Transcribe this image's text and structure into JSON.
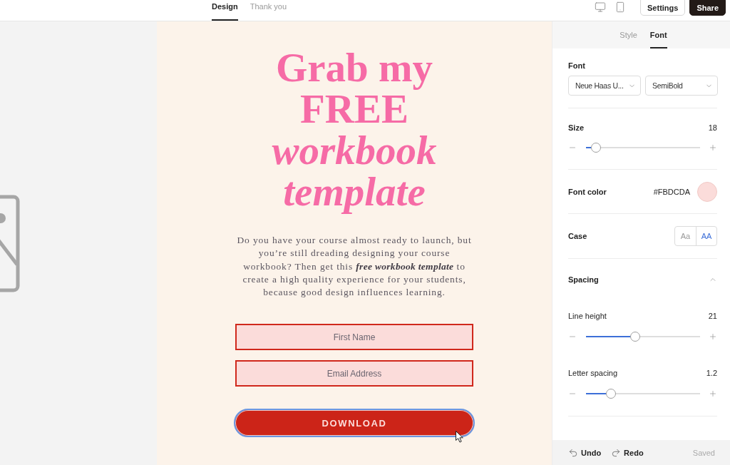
{
  "top_bar": {
    "tabs": [
      {
        "label": "Design",
        "selected": true
      },
      {
        "label": "Thank you",
        "selected": false
      }
    ],
    "buttons": [
      {
        "label": "Settings",
        "kind": "secondary"
      },
      {
        "label": "Share",
        "kind": "primary"
      }
    ]
  },
  "canvas": {
    "heading": "Grab my FREE *workbook template*",
    "body": "Do you have your course almost ready to launch, but you’re still dreading designing your course workbook? Then get this *free workbook template* to create a high quality experience for your students, because good design influences learning.",
    "fields": [
      {
        "placeholder": "First Name"
      },
      {
        "placeholder": "Email Address"
      }
    ],
    "button": {
      "label": "DOWNLOAD",
      "focused": true
    }
  },
  "panel": {
    "tabs": [
      {
        "label": "Style",
        "selected": false
      },
      {
        "label": "Font",
        "selected": true
      }
    ],
    "sections": [
      {
        "kind": "font",
        "label": "Font",
        "family": "Neue Haas U...",
        "weight": "SemiBold"
      },
      {
        "kind": "slider",
        "label": "Size",
        "value": "18",
        "level": 0.09
      },
      {
        "kind": "color",
        "label": "Font color",
        "hex": "#FBDCDA",
        "color": "#fbdcda"
      },
      {
        "kind": "case",
        "label": "Case",
        "options": [
          {
            "label": "Aa",
            "selected": false
          },
          {
            "label": "AA",
            "selected": true
          }
        ]
      },
      {
        "kind": "group",
        "label": "Spacing",
        "expanded": true,
        "controls": [
          {
            "label": "Line height",
            "value": "21",
            "level": 0.43
          },
          {
            "label": "Letter spacing",
            "value": "1.2",
            "level": 0.22
          }
        ]
      }
    ]
  },
  "footer": {
    "undo": "Undo",
    "redo": "Redo",
    "status": "Saved"
  }
}
